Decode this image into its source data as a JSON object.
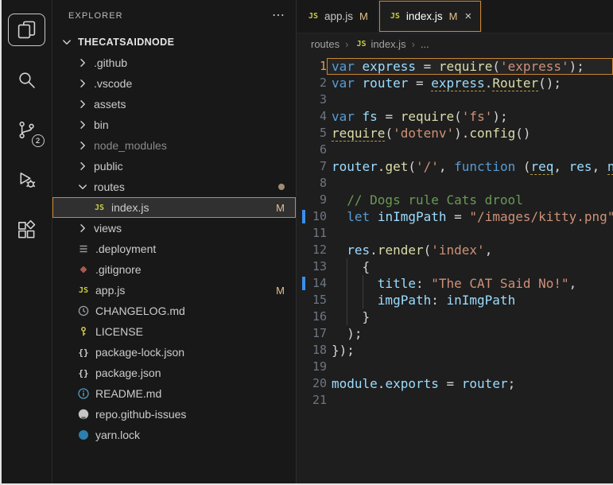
{
  "colors": {
    "accent_orange": "#cc8733",
    "git_modified": "#e2c08d",
    "modified_gutter": "#3b8eea",
    "js_icon_yellow": "#cbcb41"
  },
  "activity_bar": {
    "items": [
      {
        "id": "explorer",
        "icon": "files-icon",
        "active": true,
        "badge": ""
      },
      {
        "id": "search",
        "icon": "search-icon",
        "active": false,
        "badge": ""
      },
      {
        "id": "source-control",
        "icon": "source-control-icon",
        "active": false,
        "badge": "2"
      },
      {
        "id": "run-debug",
        "icon": "run-debug-icon",
        "active": false,
        "badge": ""
      },
      {
        "id": "extensions",
        "icon": "extensions-icon",
        "active": false,
        "badge": ""
      }
    ]
  },
  "sidebar": {
    "title": "EXPLORER",
    "more_label": "⋯",
    "tree": [
      {
        "label": "THECATSAIDNODE",
        "kind": "root",
        "chevron": "down",
        "indent": 0
      },
      {
        "label": ".github",
        "kind": "folder",
        "chevron": "right",
        "indent": 1
      },
      {
        "label": ".vscode",
        "kind": "folder",
        "chevron": "right",
        "indent": 1
      },
      {
        "label": "assets",
        "kind": "folder",
        "chevron": "right",
        "indent": 1
      },
      {
        "label": "bin",
        "kind": "folder",
        "chevron": "right",
        "indent": 1
      },
      {
        "label": "node_modules",
        "kind": "folder",
        "chevron": "right",
        "indent": 1,
        "dim": true
      },
      {
        "label": "public",
        "kind": "folder",
        "chevron": "right",
        "indent": 1
      },
      {
        "label": "routes",
        "kind": "folder",
        "chevron": "down",
        "indent": 1,
        "badge_dot": true
      },
      {
        "label": "index.js",
        "kind": "file",
        "icon": "js-icon",
        "indent": 2,
        "selected": true,
        "git_badge": "M"
      },
      {
        "label": "views",
        "kind": "folder",
        "chevron": "right",
        "indent": 1
      },
      {
        "label": ".deployment",
        "kind": "file",
        "icon": "list-icon",
        "indent": 1
      },
      {
        "label": ".gitignore",
        "kind": "file",
        "icon": "git-diamond-icon",
        "indent": 1
      },
      {
        "label": "app.js",
        "kind": "file",
        "icon": "js-icon",
        "indent": 1,
        "git_badge": "M"
      },
      {
        "label": "CHANGELOG.md",
        "kind": "file",
        "icon": "clock-icon",
        "indent": 1
      },
      {
        "label": "LICENSE",
        "kind": "file",
        "icon": "key-icon",
        "indent": 1
      },
      {
        "label": "package-lock.json",
        "kind": "file",
        "icon": "braces-icon",
        "indent": 1
      },
      {
        "label": "package.json",
        "kind": "file",
        "icon": "braces-icon",
        "indent": 1
      },
      {
        "label": "README.md",
        "kind": "file",
        "icon": "info-icon",
        "indent": 1
      },
      {
        "label": "repo.github-issues",
        "kind": "file",
        "icon": "github-icon",
        "indent": 1
      },
      {
        "label": "yarn.lock",
        "kind": "file",
        "icon": "yarn-icon",
        "indent": 1
      }
    ]
  },
  "editor": {
    "tabs": [
      {
        "label": "app.js",
        "icon": "js-icon",
        "git_badge": "M",
        "active": false,
        "close_label": ""
      },
      {
        "label": "index.js",
        "icon": "js-icon",
        "git_badge": "M",
        "active": true,
        "close_label": "×"
      }
    ],
    "breadcrumb_separator": "›",
    "breadcrumb": [
      {
        "label": "routes",
        "icon": ""
      },
      {
        "label": "index.js",
        "icon": "js-icon"
      },
      {
        "label": "...",
        "icon": ""
      }
    ],
    "code": {
      "lines": [
        {
          "n": 1,
          "highlight": true,
          "tokens": [
            {
              "c": "kw",
              "t": "var"
            },
            {
              "c": "pn",
              "t": " "
            },
            {
              "c": "vr",
              "t": "express"
            },
            {
              "c": "pn",
              "t": " = "
            },
            {
              "c": "fn",
              "t": "require"
            },
            {
              "c": "pn",
              "t": "("
            },
            {
              "c": "str",
              "t": "'express'",
              "u": true
            },
            {
              "c": "pn",
              "t": ");"
            }
          ]
        },
        {
          "n": 2,
          "tokens": [
            {
              "c": "kw",
              "t": "var"
            },
            {
              "c": "pn",
              "t": " "
            },
            {
              "c": "vr",
              "t": "router"
            },
            {
              "c": "pn",
              "t": " = "
            },
            {
              "c": "vr",
              "t": "express",
              "u": true
            },
            {
              "c": "pn",
              "t": "."
            },
            {
              "c": "fn",
              "t": "Router",
              "u": true
            },
            {
              "c": "pn",
              "t": "();"
            }
          ]
        },
        {
          "n": 3,
          "tokens": []
        },
        {
          "n": 4,
          "tokens": [
            {
              "c": "kw",
              "t": "var"
            },
            {
              "c": "pn",
              "t": " "
            },
            {
              "c": "vr",
              "t": "fs"
            },
            {
              "c": "pn",
              "t": " = "
            },
            {
              "c": "fn",
              "t": "require"
            },
            {
              "c": "pn",
              "t": "("
            },
            {
              "c": "str",
              "t": "'fs'"
            },
            {
              "c": "pn",
              "t": ");"
            }
          ]
        },
        {
          "n": 5,
          "tokens": [
            {
              "c": "fn",
              "t": "require",
              "u": true
            },
            {
              "c": "pn",
              "t": "("
            },
            {
              "c": "str",
              "t": "'dotenv'"
            },
            {
              "c": "pn",
              "t": ")."
            },
            {
              "c": "fn",
              "t": "config"
            },
            {
              "c": "pn",
              "t": "()"
            }
          ]
        },
        {
          "n": 6,
          "tokens": []
        },
        {
          "n": 7,
          "tokens": [
            {
              "c": "vr",
              "t": "router"
            },
            {
              "c": "pn",
              "t": "."
            },
            {
              "c": "fn",
              "t": "get"
            },
            {
              "c": "pn",
              "t": "("
            },
            {
              "c": "str",
              "t": "'/'"
            },
            {
              "c": "pn",
              "t": ", "
            },
            {
              "c": "kw",
              "t": "function"
            },
            {
              "c": "pn",
              "t": " ("
            },
            {
              "c": "vr",
              "t": "req",
              "u": true
            },
            {
              "c": "pn",
              "t": ", "
            },
            {
              "c": "vr",
              "t": "res"
            },
            {
              "c": "pn",
              "t": ", "
            },
            {
              "c": "vr",
              "t": "next",
              "u": true
            },
            {
              "c": "pn",
              "t": ") {"
            }
          ]
        },
        {
          "n": 8,
          "tokens": []
        },
        {
          "n": 9,
          "indent": 2,
          "tokens": [
            {
              "c": "cm",
              "t": "// Dogs rule Cats drool"
            }
          ]
        },
        {
          "n": 10,
          "indent": 2,
          "modified": true,
          "tokens": [
            {
              "c": "kw",
              "t": "let"
            },
            {
              "c": "pn",
              "t": " "
            },
            {
              "c": "vr",
              "t": "inImgPath"
            },
            {
              "c": "pn",
              "t": " = "
            },
            {
              "c": "str",
              "t": "\"/images/kitty.png\""
            },
            {
              "c": "pn",
              "t": ";"
            }
          ]
        },
        {
          "n": 11,
          "tokens": []
        },
        {
          "n": 12,
          "indent": 2,
          "tokens": [
            {
              "c": "vr",
              "t": "res"
            },
            {
              "c": "pn",
              "t": "."
            },
            {
              "c": "fn",
              "t": "render"
            },
            {
              "c": "pn",
              "t": "("
            },
            {
              "c": "str",
              "t": "'index'"
            },
            {
              "c": "pn",
              "t": ","
            }
          ]
        },
        {
          "n": 13,
          "indent": 4,
          "tokens": [
            {
              "c": "pn",
              "t": "{"
            }
          ]
        },
        {
          "n": 14,
          "indent": 6,
          "modified": true,
          "tokens": [
            {
              "c": "vr",
              "t": "title"
            },
            {
              "c": "pn",
              "t": ": "
            },
            {
              "c": "str",
              "t": "\"The CAT Said No!\""
            },
            {
              "c": "pn",
              "t": ","
            }
          ]
        },
        {
          "n": 15,
          "indent": 6,
          "tokens": [
            {
              "c": "vr",
              "t": "imgPath"
            },
            {
              "c": "pn",
              "t": ": "
            },
            {
              "c": "vr",
              "t": "inImgPath"
            }
          ]
        },
        {
          "n": 16,
          "indent": 4,
          "tokens": [
            {
              "c": "pn",
              "t": "}"
            }
          ]
        },
        {
          "n": 17,
          "indent": 2,
          "tokens": [
            {
              "c": "pn",
              "t": ");"
            }
          ]
        },
        {
          "n": 18,
          "tokens": [
            {
              "c": "pn",
              "t": "});"
            }
          ]
        },
        {
          "n": 19,
          "tokens": []
        },
        {
          "n": 20,
          "tokens": [
            {
              "c": "vr",
              "t": "module"
            },
            {
              "c": "pn",
              "t": "."
            },
            {
              "c": "vr",
              "t": "exports"
            },
            {
              "c": "pn",
              "t": " = "
            },
            {
              "c": "vr",
              "t": "router"
            },
            {
              "c": "pn",
              "t": ";"
            }
          ]
        },
        {
          "n": 21,
          "tokens": []
        }
      ]
    }
  }
}
